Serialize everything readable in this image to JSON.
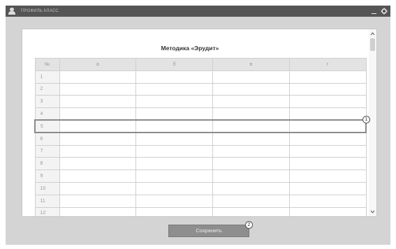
{
  "window": {
    "title": "ПРОФИЛЬ КЛАСС"
  },
  "panel": {
    "title": "Методика «Эрудит»"
  },
  "table": {
    "columns": [
      "№",
      "а",
      "б",
      "в",
      "г"
    ],
    "rows": [
      "1",
      "2",
      "3",
      "4",
      "5",
      "6",
      "7",
      "8",
      "9",
      "10",
      "11",
      "12"
    ],
    "highlighted_row": "5"
  },
  "callouts": {
    "one": "1",
    "two": "2"
  },
  "actions": {
    "save_label": "Сохранить"
  },
  "colors": {
    "titlebar": "#555555",
    "button": "#8e8e8e",
    "highlight_border": "#8a8a8a"
  },
  "icons": {
    "app": "user-icon",
    "minimize": "minimize-icon",
    "settings": "gear-icon"
  }
}
